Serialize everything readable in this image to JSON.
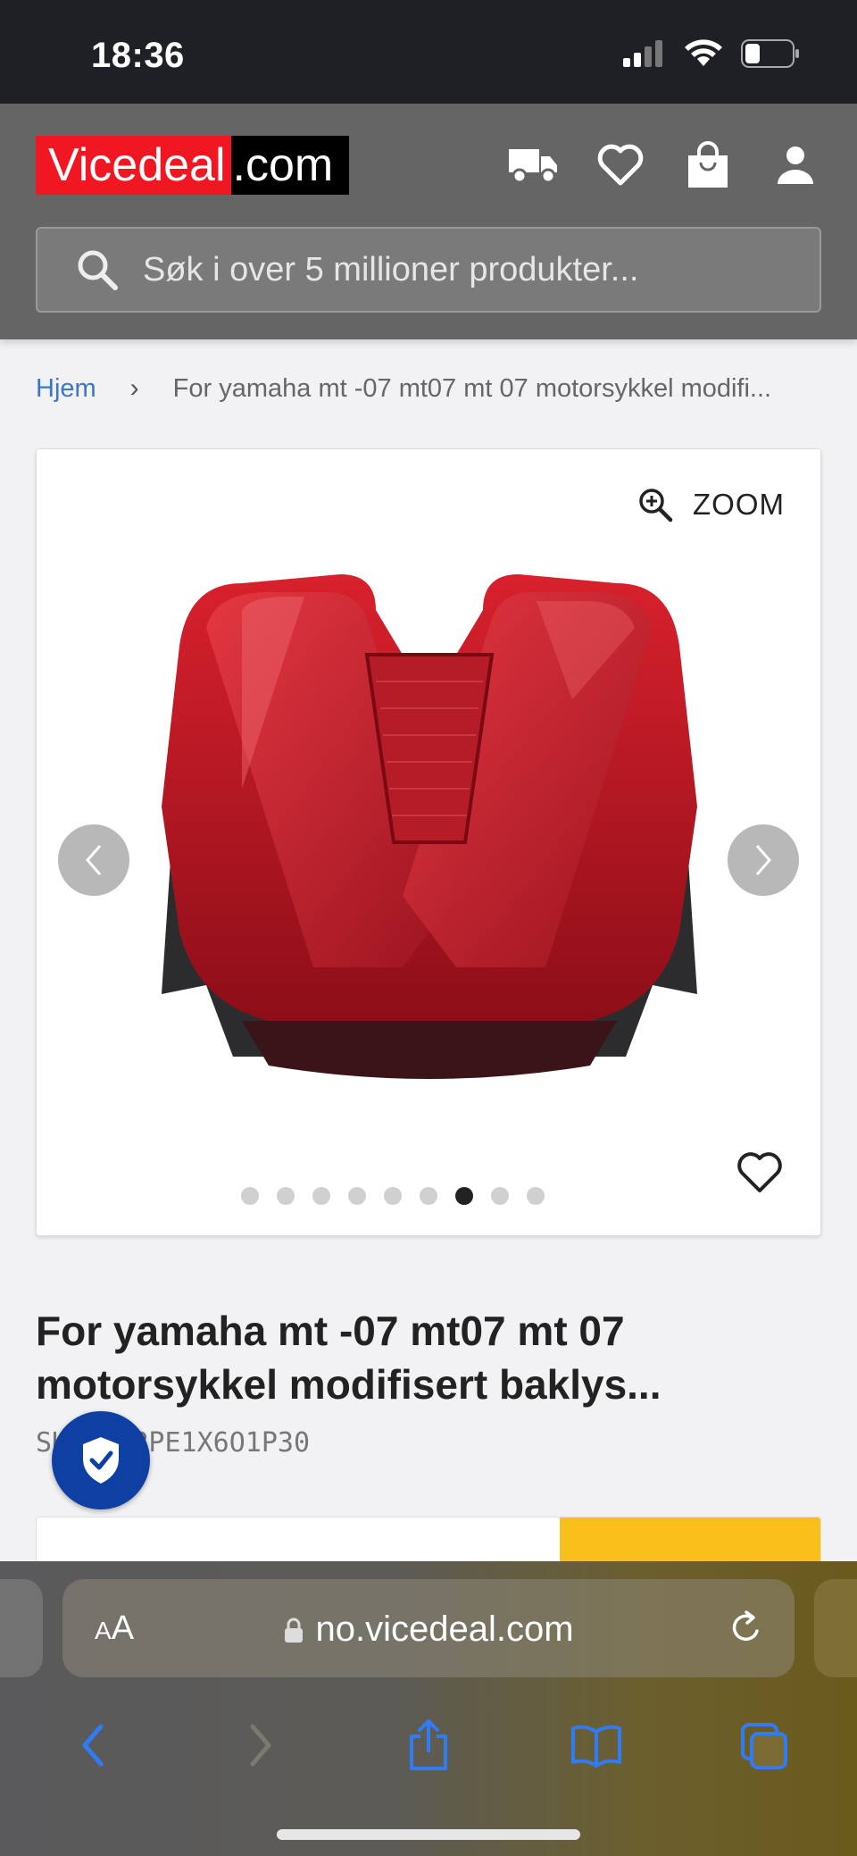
{
  "status_bar": {
    "time": "18:36"
  },
  "header": {
    "logo_part1": "Vicedeal",
    "logo_part2": ".com",
    "icons": [
      "truck-icon",
      "heart-icon",
      "shopping-bag-icon",
      "user-icon"
    ],
    "search_placeholder": "Søk i over 5 millioner produkter..."
  },
  "breadcrumb": {
    "home": "Hjem",
    "separator": "›",
    "current": "For yamaha mt -07 mt07 mt 07 motorsykkel modifi..."
  },
  "gallery": {
    "zoom_label": "ZOOM",
    "image_count": 9,
    "active_index": 6
  },
  "product": {
    "title": "For yamaha mt -07 mt07 mt 07 motorsykkel modifisert baklys...",
    "sku": "SKU: -RPE1X6O1P30"
  },
  "browser": {
    "aa_label_small": "A",
    "aa_label_large": "A",
    "url": "no.vicedeal.com"
  },
  "colors": {
    "brand_red": "#f01622",
    "link_blue": "#3b76c8",
    "accent_yellow": "#f9c01b",
    "badge_blue": "#0e3fa3",
    "ios_blue": "#2f7cf6"
  }
}
